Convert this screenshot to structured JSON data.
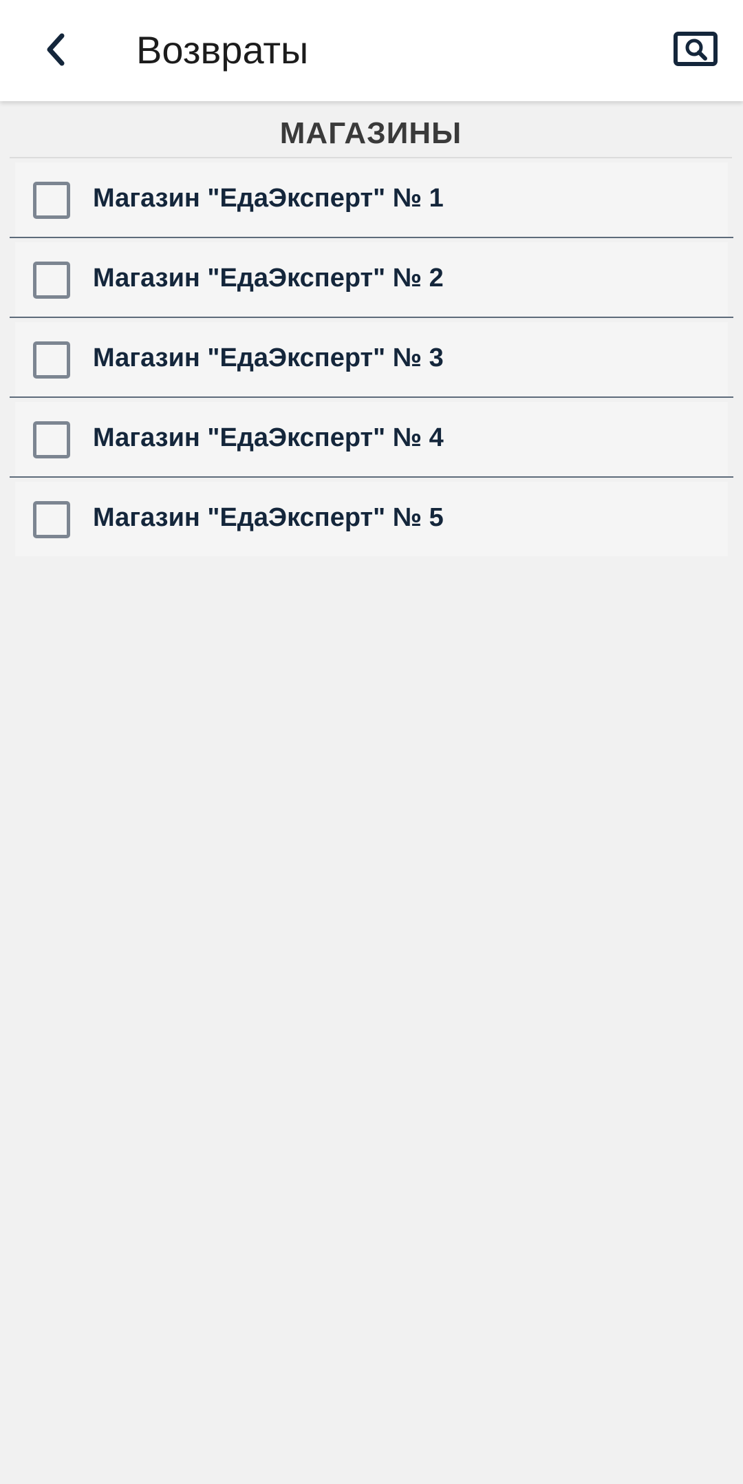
{
  "app_bar": {
    "title": "Возвраты",
    "back_icon": "chevron-left-icon",
    "search_icon": "search-icon"
  },
  "section": {
    "title": "МАГАЗИНЫ"
  },
  "stores": [
    {
      "label": "Магазин \"ЕдаЭксперт\" № 1",
      "checked": false
    },
    {
      "label": "Магазин \"ЕдаЭксперт\" № 2",
      "checked": false
    },
    {
      "label": "Магазин \"ЕдаЭксперт\" № 3",
      "checked": false
    },
    {
      "label": "Магазин \"ЕдаЭксперт\" № 4",
      "checked": false
    },
    {
      "label": "Магазин \"ЕдаЭксперт\" № 5",
      "checked": false
    }
  ],
  "colors": {
    "accent_dark": "#14263b",
    "background": "#f1f1f1",
    "checkbox_border": "#7c8591"
  }
}
